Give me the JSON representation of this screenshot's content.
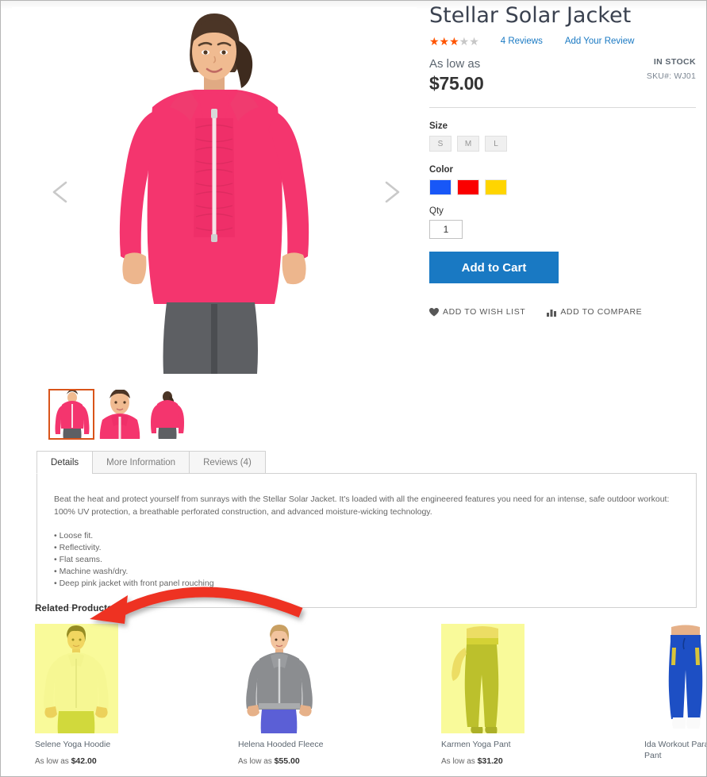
{
  "product": {
    "title": "Stellar Solar Jacket",
    "rating_stars_filled": 3,
    "rating_stars_total": 5,
    "reviews_link": "4  Reviews",
    "add_review_link": "Add Your Review",
    "as_low_as_label": "As low as",
    "price": "$75.00",
    "stock_status": "IN STOCK",
    "sku": "SKU#:  WJ01",
    "colors_accent": {
      "star_on": "#ff5501",
      "star_off": "#c7c7c7",
      "link": "#1979c3",
      "button": "#1979c3",
      "thumb_active_border": "#d9541a",
      "jacket": "#f4356e"
    }
  },
  "gallery": {
    "prev_label": "Previous image",
    "next_label": "Next image",
    "thumbs": [
      {
        "alt": "Stellar Solar Jacket front view",
        "active": true
      },
      {
        "alt": "Stellar Solar Jacket close-up",
        "active": false
      },
      {
        "alt": "Stellar Solar Jacket back view",
        "active": false
      }
    ]
  },
  "options": {
    "size_label": "Size",
    "sizes": [
      "S",
      "M",
      "L"
    ],
    "color_label": "Color",
    "colors": [
      {
        "name": "Blue",
        "hex": "#1857f7"
      },
      {
        "name": "Red",
        "hex": "#fa0000"
      },
      {
        "name": "Yellow",
        "hex": "#ffd500"
      }
    ],
    "qty_label": "Qty",
    "qty_value": "1",
    "add_to_cart_label": "Add to Cart",
    "wishlist_label": "ADD TO WISH LIST",
    "compare_label": "ADD TO COMPARE"
  },
  "tabs": [
    {
      "label": "Details",
      "active": true
    },
    {
      "label": "More Information",
      "active": false
    },
    {
      "label": "Reviews (4)",
      "active": false
    }
  ],
  "details": {
    "paragraph": "Beat the heat and protect yourself from sunrays with the Stellar Solar Jacket. It's loaded with all the engineered features you need for an intense, safe outdoor workout: 100% UV protection, a breathable perforated construction, and advanced moisture-wicking technology.",
    "bullets": [
      "• Loose fit.",
      "• Reflectivity.",
      "• Flat seams.",
      "• Machine wash/dry.",
      "• Deep pink jacket with front panel rouching"
    ]
  },
  "related": {
    "title": "Related Products",
    "items": [
      {
        "name": "Selene Yoga Hoodie",
        "price_prefix": "As low as ",
        "price": "$42.00",
        "highlighted": true
      },
      {
        "name": "Helena Hooded Fleece",
        "price_prefix": "As low as ",
        "price": "$55.00",
        "highlighted": false
      },
      {
        "name": "Karmen Yoga Pant",
        "price_prefix": "As low as ",
        "price": "$31.20",
        "highlighted": true
      },
      {
        "name": "Ida Workout Parachute Pant",
        "price_prefix": "",
        "price": "",
        "highlighted": false
      }
    ],
    "highlight_color": "#f2f528"
  },
  "annotation": {
    "type": "arrow",
    "color": "#ee3124",
    "points_to": "Related Products"
  }
}
